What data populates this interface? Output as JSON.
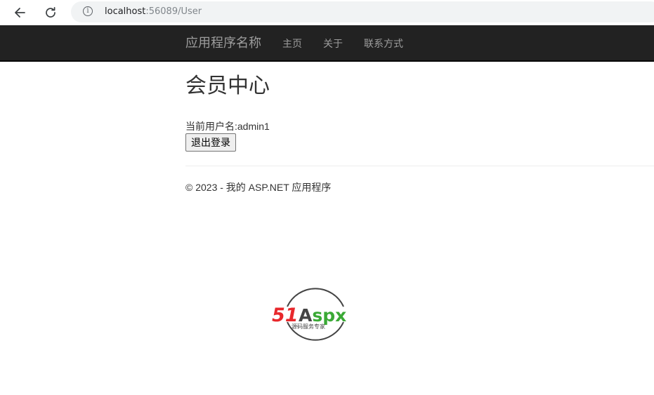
{
  "browser": {
    "url_host": "localhost",
    "url_rest": ":56089/User",
    "info_icon": "info-icon",
    "back_icon": "arrow-left-icon",
    "reload_icon": "reload-icon"
  },
  "navbar": {
    "brand": "应用程序名称",
    "links": [
      "主页",
      "关于",
      "联系方式"
    ],
    "background": "#222222",
    "link_color": "#9d9d9d"
  },
  "main": {
    "title": "会员中心",
    "user_label": "当前用户名:",
    "username": "admin1",
    "logout_label": "退出登录"
  },
  "footer": {
    "copyright": "© 2023 - 我的 ASP.NET 应用程序"
  },
  "watermark": {
    "text_51": "51",
    "text_aspx": "Aspx",
    "tagline": "源码服务专家",
    "colors": {
      "red": "#e8282c",
      "green": "#3aa935",
      "dark": "#444444"
    }
  }
}
